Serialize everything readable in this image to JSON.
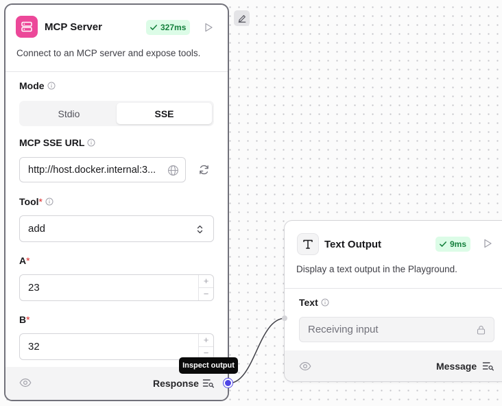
{
  "mcp_node": {
    "title": "MCP Server",
    "icon": "server-icon",
    "badge": "327ms",
    "description": "Connect to an MCP server and expose tools.",
    "mode": {
      "label": "Mode",
      "options": [
        "Stdio",
        "SSE"
      ],
      "selected": "SSE"
    },
    "url": {
      "label": "MCP SSE URL",
      "value": "http://host.docker.internal:3..."
    },
    "tool": {
      "label": "Tool",
      "required": "*",
      "value": "add"
    },
    "a": {
      "label": "A",
      "required": "*",
      "value": "23"
    },
    "b": {
      "label": "B",
      "required": "*",
      "value": "32"
    },
    "footer": {
      "output_label": "Response"
    }
  },
  "tooltip": "Inspect output",
  "text_node": {
    "title": "Text Output",
    "icon": "text-type-icon",
    "badge": "9ms",
    "description": "Display a text output in the Playground.",
    "text_field": {
      "label": "Text",
      "placeholder": "Receiving input"
    },
    "footer": {
      "output_label": "Message"
    }
  },
  "colors": {
    "accent_pink": "#ec4899",
    "badge_green": "#15803d",
    "handle_blue": "#4f46e5"
  }
}
